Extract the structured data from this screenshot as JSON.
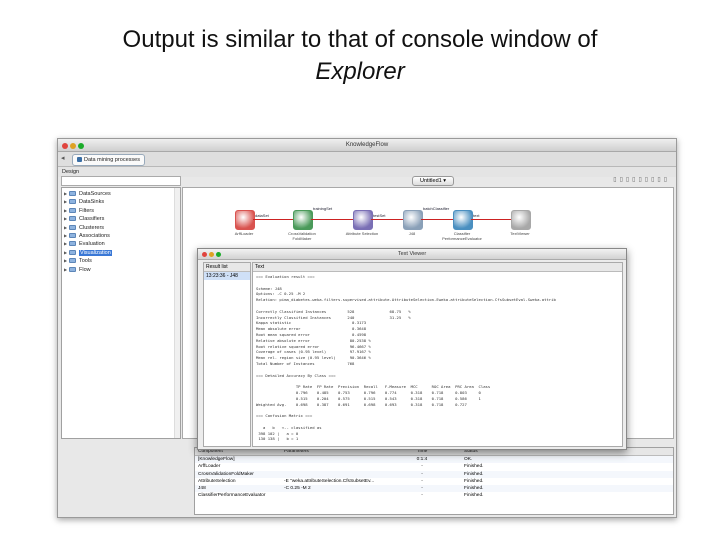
{
  "slide": {
    "title_line1": "Output is similar to that of console window of",
    "title_line2": "Explorer"
  },
  "window": {
    "title": "KnowledgeFlow",
    "traffic_colors": [
      "#e0443e",
      "#dea123",
      "#1aab29"
    ]
  },
  "tabbar": {
    "tab_label": "Data mining processes"
  },
  "design": {
    "label": "Design",
    "items": [
      {
        "label": "DataSources"
      },
      {
        "label": "DataSinks"
      },
      {
        "label": "Filters"
      },
      {
        "label": "Classifiers"
      },
      {
        "label": "Clusterers"
      },
      {
        "label": "Associations"
      },
      {
        "label": "Evaluation"
      },
      {
        "label": "Visualization",
        "selected": true
      },
      {
        "label": "Tools"
      },
      {
        "label": "Flow"
      }
    ]
  },
  "canvas": {
    "undock_label": "Untitled1",
    "nodes": [
      {
        "label": "ArffLoader",
        "color": "#d9534f"
      },
      {
        "label": "CrossValidation FoldMaker",
        "color": "#4a9a5a"
      },
      {
        "label": "Attribute Selection",
        "color": "#7a6fb5"
      },
      {
        "label": "J48",
        "color": "#8aa0b8"
      },
      {
        "label": "Classifier PerformanceEvaluator",
        "color": "#4a8fc0"
      },
      {
        "label": "TextViewer",
        "color": "#a8a8a8"
      }
    ],
    "connections": [
      {
        "label": "dataSet"
      },
      {
        "label": "trainingSet"
      },
      {
        "label": "testSet"
      },
      {
        "label": "batchClassifier"
      },
      {
        "label": "text"
      }
    ]
  },
  "status_table": {
    "headers": [
      "Component",
      "Parameters",
      "Time",
      "Status"
    ],
    "rows": [
      {
        "component": "[KnowledgeFlow]",
        "parameters": "",
        "time": "0:1:4",
        "status": "OK."
      },
      {
        "component": "ArffLoader",
        "parameters": "",
        "time": "-",
        "status": "Finished."
      },
      {
        "component": "CrossValidationFoldMaker",
        "parameters": "",
        "time": "-",
        "status": "Finished."
      },
      {
        "component": "AttributeSelection",
        "parameters": "-E \"weka.attributeSelection.CfsSubsetEv...",
        "time": "-",
        "status": "Finished."
      },
      {
        "component": "J48",
        "parameters": "-C 0.25 -M 2",
        "time": "-",
        "status": "Finished."
      },
      {
        "component": "ClassifierPerformanceEvaluator",
        "parameters": "",
        "time": "-",
        "status": "Finished."
      }
    ]
  },
  "text_viewer": {
    "title": "Text Viewer",
    "result_list_label": "Result list",
    "result_item": "13:23:36 - J48",
    "text_label": "Text",
    "output": "=== Evaluation result ===\n\nScheme: J48\nOptions: -C 0.25 -M 2\nRelation: pima_diabetes-weka.filters.supervised.attribute.AttributeSelection-Eweka.attributeSelection.CfsSubsetEval-Sweka.attrib\n\nCorrectly Classified Instances         528               68.75   %\nIncorrectly Classified Instances       240               31.25   %\nKappa statistic                          0.3173\nMean absolute error                      0.3648\nRoot mean squared error                  0.4598\nRelative absolute error                 80.2538 %\nRoot relative squared error             96.4667 %\nCoverage of cases (0.95 level)          97.9167 %\nMean rel. region size (0.95 level)      90.3646 %\nTotal Number of Instances              768\n\n=== Detailed Accuracy By Class ===\n\n                 TP Rate  FP Rate  Precision  Recall   F-Measure  MCC      ROC Area  PRC Area  Class\n                 0.796    0.485    0.753      0.796    0.774      0.318    0.718     0.803     0\n                 0.515    0.204    0.575      0.515    0.543      0.318    0.718     0.586     1\nWeighted Avg.    0.698    0.387    0.691      0.698    0.693      0.318    0.718     0.727\n\n=== Confusion Matrix ===\n\n   a   b   <-- classified as\n 398 102 |   a = 0\n 130 138 |   b = 1"
  }
}
